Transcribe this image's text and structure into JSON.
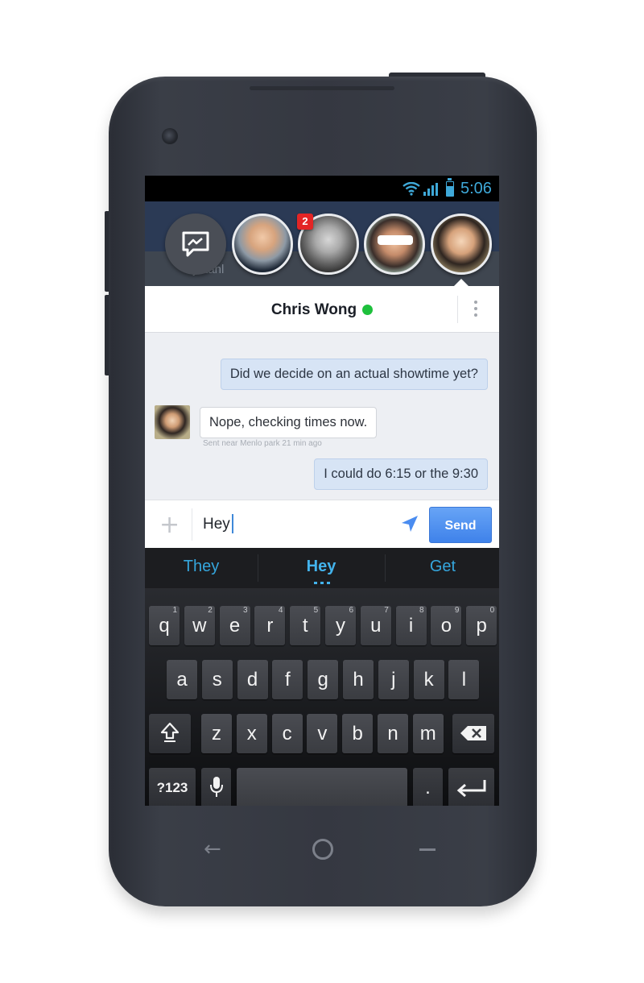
{
  "status_bar": {
    "time": "5:06"
  },
  "background_app": {
    "snippet": "jistahl"
  },
  "chat_heads": {
    "badge_count": "2"
  },
  "conversation": {
    "contact_name": "Chris Wong",
    "messages": [
      {
        "direction": "out",
        "text": "Did we decide on an actual showtime yet?"
      },
      {
        "direction": "in",
        "text": "Nope, checking times now.",
        "meta": "Sent near Menlo park 21 min ago"
      },
      {
        "direction": "out",
        "text": "I could do 6:15 or the 9:30"
      }
    ]
  },
  "composer": {
    "input_value": "Hey",
    "send_label": "Send"
  },
  "keyboard": {
    "suggestions": [
      "They",
      "Hey",
      "Get"
    ],
    "row1": [
      {
        "k": "q",
        "h": "1"
      },
      {
        "k": "w",
        "h": "2"
      },
      {
        "k": "e",
        "h": "3"
      },
      {
        "k": "r",
        "h": "4"
      },
      {
        "k": "t",
        "h": "5"
      },
      {
        "k": "y",
        "h": "6"
      },
      {
        "k": "u",
        "h": "7"
      },
      {
        "k": "i",
        "h": "8"
      },
      {
        "k": "o",
        "h": "9"
      },
      {
        "k": "p",
        "h": "0"
      }
    ],
    "row2": [
      "a",
      "s",
      "d",
      "f",
      "g",
      "h",
      "j",
      "k",
      "l"
    ],
    "row3": [
      "z",
      "x",
      "c",
      "v",
      "b",
      "n",
      "m"
    ],
    "symbols_label": "?123",
    "period_label": "."
  },
  "icons": {
    "status": [
      "wifi-icon",
      "signal-icon",
      "battery-icon"
    ],
    "chat": [
      "messenger-icon",
      "more-icon",
      "plus-icon",
      "location-icon"
    ],
    "keyboard": [
      "shift-icon",
      "backspace-icon",
      "mic-icon",
      "enter-icon"
    ],
    "navigation": [
      "back-icon",
      "home-icon",
      "recent-apps-icon"
    ]
  },
  "colors": {
    "accent_blue": "#3fa9d9",
    "send_button": "#4a8cf0",
    "online_green": "#1ec03c",
    "badge_red": "#e32525",
    "outgoing_bubble": "#d7e4f5"
  }
}
